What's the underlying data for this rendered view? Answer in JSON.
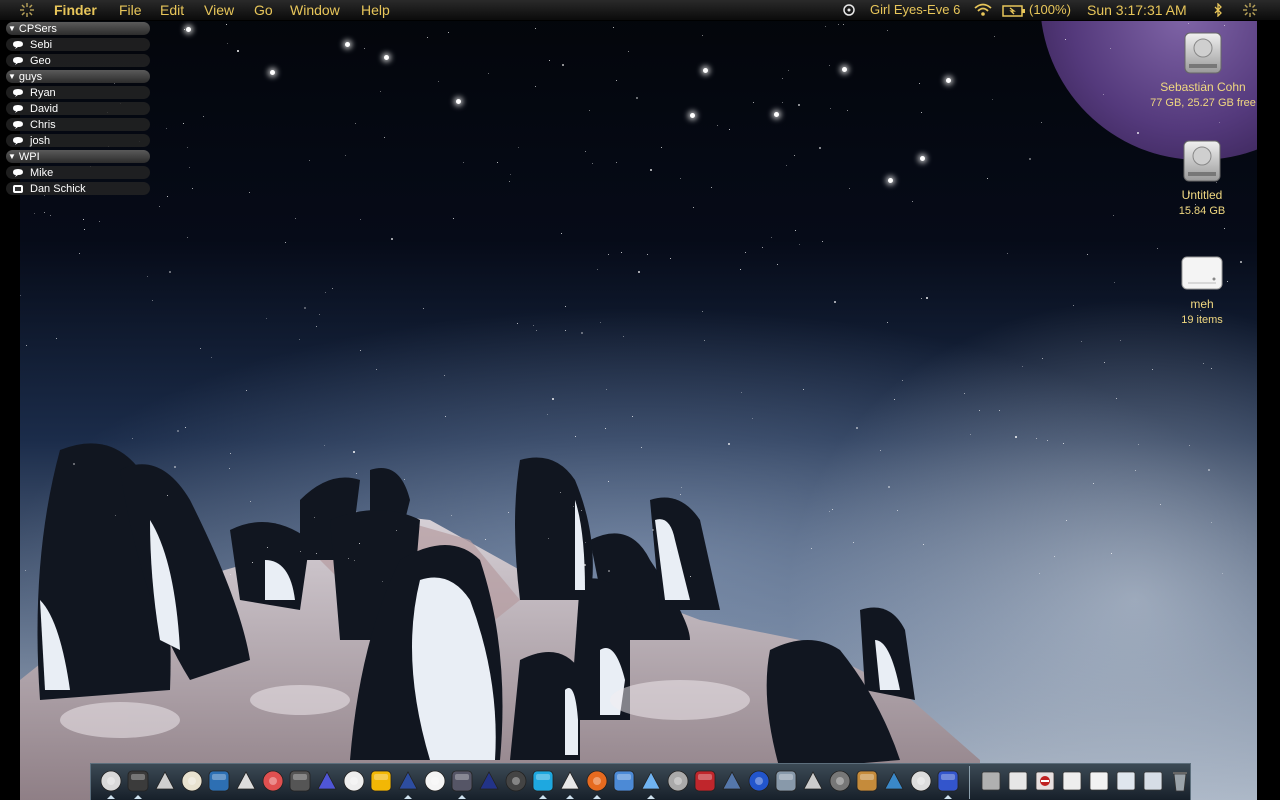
{
  "menubar": {
    "app_name": "Finder",
    "menus": [
      "File",
      "Edit",
      "View",
      "Go",
      "Window",
      "Help"
    ],
    "now_playing": "Girl Eyes-Eve 6",
    "battery": "(100%)",
    "clock": "Sun 3:17:31 AM",
    "text_color": "#e8c65a"
  },
  "buddy_list": {
    "groups": [
      {
        "name": "CPSers",
        "buddies": [
          "Sebi",
          "Geo"
        ]
      },
      {
        "name": "guys",
        "buddies": [
          "Ryan",
          "David",
          "Chris",
          "josh"
        ]
      },
      {
        "name": "WPI",
        "buddies": [
          "Mike",
          "Dan Schick"
        ]
      }
    ]
  },
  "desktop_icons": [
    {
      "name": "Sebastian Cohn",
      "info": "77 GB, 25.27 GB free",
      "icon": "hard-drive-icon"
    },
    {
      "name": "Untitled",
      "info": "15.84 GB",
      "icon": "hard-drive-icon"
    },
    {
      "name": "meh",
      "info": "19 items",
      "icon": "external-drive-icon"
    }
  ],
  "dock": {
    "app_icons": [
      "finder-icon",
      "dashboard-icon",
      "mail-stamp-icon",
      "textedit-icon",
      "dreamweaver-icon",
      "script-editor-icon",
      "color-picker-icon",
      "spotlight-icon",
      "bluetooth-app-icon",
      "cards-icon",
      "mathematica-icon",
      "blitzmax-icon",
      "checkmark-app-icon",
      "unreal-editor-icon",
      "unreal-tournament-icon",
      "gamepad-icon",
      "skype-icon",
      "chat-bubble-icon",
      "firefox-icon",
      "preview-icon",
      "itunes-icon",
      "disk-utility-icon",
      "red-app-icon",
      "photo-icon",
      "globe-icon",
      "image-capture-icon",
      "pen-icon",
      "timemachine-icon",
      "butter-icon",
      "joystick-icon",
      "quill-icon",
      "shapeshifter-icon"
    ],
    "doc_icons": [
      "hard-disk-icon",
      "open-book-icon",
      "no-entry-folder-icon",
      "book-icon",
      "document-icon",
      "windows-icon",
      "stack-icon",
      "trash-icon"
    ]
  }
}
